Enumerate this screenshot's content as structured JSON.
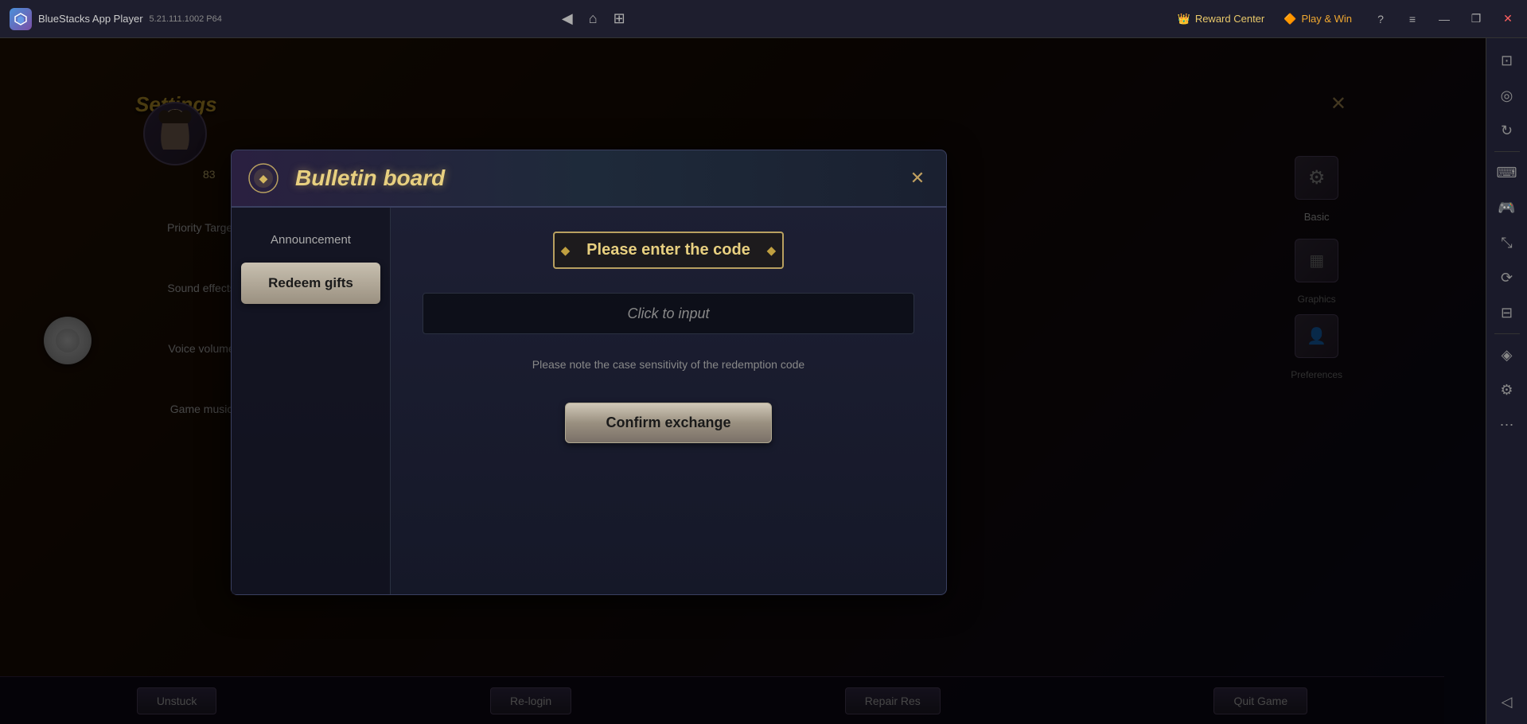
{
  "titlebar": {
    "logo_text": "BS",
    "app_name": "BlueStacks App Player",
    "version": "5.21.111.1002  P64",
    "nav_back": "◀",
    "nav_home": "⌂",
    "nav_tabs": "⊞",
    "reward_center_icon": "👑",
    "reward_center_label": "Reward Center",
    "play_win_icon": "🔶",
    "play_win_label": "Play & Win",
    "help_icon": "?",
    "menu_icon": "≡",
    "minimize_icon": "—",
    "restore_icon": "❐",
    "close_icon": "✕"
  },
  "right_sidebar": {
    "icons": [
      {
        "name": "screenshot-icon",
        "glyph": "⊡"
      },
      {
        "name": "camera-icon",
        "glyph": "◎"
      },
      {
        "name": "video-icon",
        "glyph": "▶"
      },
      {
        "name": "keyboard-icon",
        "glyph": "⌨"
      },
      {
        "name": "gamepad-icon",
        "glyph": "🎮"
      },
      {
        "name": "scale-icon",
        "glyph": "⤡"
      },
      {
        "name": "rotate-icon",
        "glyph": "↻"
      },
      {
        "name": "layers-icon",
        "glyph": "⊟"
      },
      {
        "name": "settings-icon",
        "glyph": "⚙"
      },
      {
        "name": "more-icon",
        "glyph": "⋯"
      },
      {
        "name": "arrow-icon",
        "glyph": "◁"
      }
    ]
  },
  "settings": {
    "title": "Settings",
    "close_icon": "✕",
    "menu_items": [
      {
        "label": "Priority Target"
      },
      {
        "label": "Sound effects"
      },
      {
        "label": "Voice volume"
      },
      {
        "label": "Game music"
      }
    ],
    "character_level": "83"
  },
  "bulletin_board": {
    "title": "Bulletin board",
    "close_icon": "✕",
    "tabs": [
      {
        "label": "Announcement",
        "active": false
      },
      {
        "label": "Redeem gifts",
        "active": true
      }
    ],
    "code_section": {
      "title": "Please enter the code",
      "input_placeholder": "Click to input",
      "note": "Please note the case sensitivity of the redemption code",
      "confirm_button": "Confirm exchange"
    }
  },
  "bottom_bar": {
    "buttons": [
      {
        "label": "Unstuck"
      },
      {
        "label": "Re-login"
      },
      {
        "label": "Repair Res"
      },
      {
        "label": "Quit Game"
      }
    ]
  },
  "right_panel": {
    "basic_label": "Basic",
    "graphics_label": "Graphics",
    "preferences_label": "Preferences"
  }
}
